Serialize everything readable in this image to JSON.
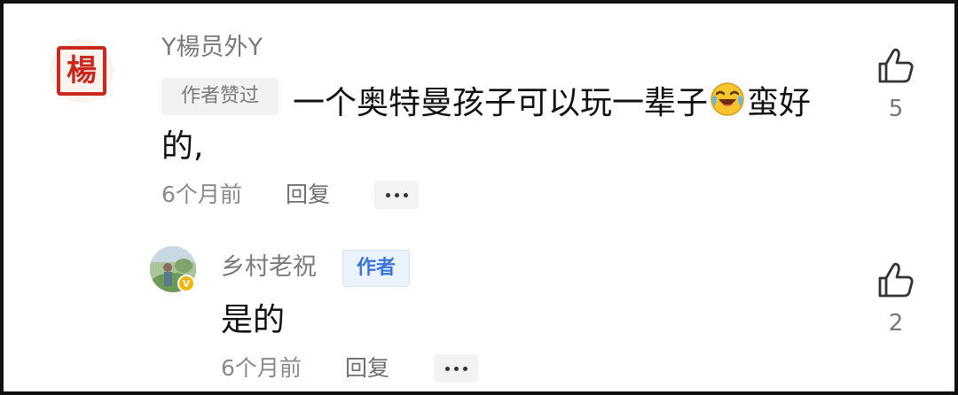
{
  "comment": {
    "username": "Y楊员外Y",
    "avatar_text": "楊",
    "liked_tag": "作者赞过",
    "text_part1": "一个奥特曼孩子可以玩一辈子",
    "text_part2": "蛮好",
    "text_part3": "的,",
    "time": "6个月前",
    "reply_label": "回复",
    "like_count": "5"
  },
  "reply": {
    "username": "乡村老祝",
    "author_tag": "作者",
    "badge": "V",
    "text": "是的",
    "time": "6个月前",
    "reply_label": "回复",
    "like_count": "2"
  },
  "icons": {
    "like": "thumbs-up-icon",
    "more": "more-dots-icon",
    "emoji": "laughing-crying-emoji"
  },
  "colors": {
    "seal_red": "#c8281e",
    "author_blue": "#3b74d6",
    "meta_gray": "#8a8a8a"
  }
}
